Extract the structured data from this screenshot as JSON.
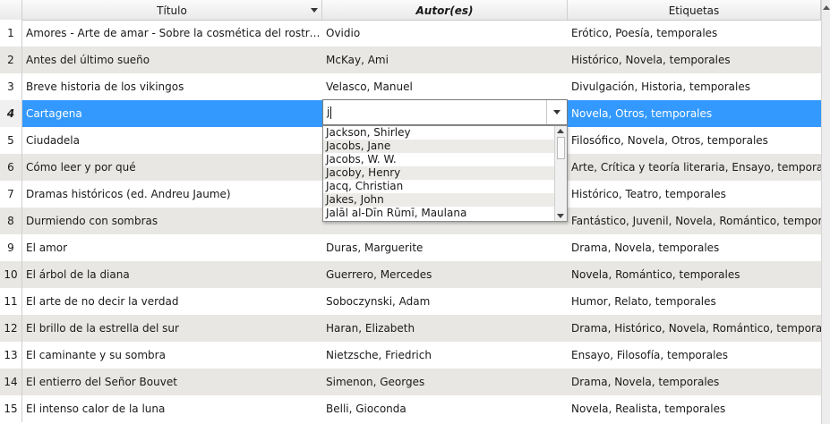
{
  "columns": {
    "title": "Título",
    "authors": "Autor(es)",
    "tags": "Etiquetas"
  },
  "rows": [
    {
      "num": "1",
      "title": "Amores - Arte de amar - Sobre la cosmética del rostro femenino",
      "author": "Ovidio",
      "tags": "Erótico, Poesía, temporales"
    },
    {
      "num": "2",
      "title": "Antes del último sueño",
      "author": "McKay, Ami",
      "tags": "Histórico, Novela, temporales"
    },
    {
      "num": "3",
      "title": "Breve historia de los vikingos",
      "author": "Velasco, Manuel",
      "tags": "Divulgación, Historia, temporales"
    },
    {
      "num": "4",
      "title": "Cartagena",
      "author": "",
      "tags": "Novela, Otros, temporales"
    },
    {
      "num": "5",
      "title": "Ciudadela",
      "author": "",
      "tags": "Filosófico, Novela, Otros, temporales"
    },
    {
      "num": "6",
      "title": "Cómo leer y por qué",
      "author": "",
      "tags": "Arte, Crítica y teoría literaria, Ensayo, temporales"
    },
    {
      "num": "7",
      "title": "Dramas históricos (ed. Andreu Jaume)",
      "author": "",
      "tags": "Histórico, Teatro, temporales"
    },
    {
      "num": "8",
      "title": "Durmiendo con sombras",
      "author": "",
      "tags": "Fantástico, Juvenil, Novela, Romántico, temporales"
    },
    {
      "num": "9",
      "title": "El amor",
      "author": "Duras, Marguerite",
      "tags": "Drama, Novela, temporales"
    },
    {
      "num": "10",
      "title": "El árbol de la diana",
      "author": "Guerrero, Mercedes",
      "tags": "Novela, Romántico, temporales"
    },
    {
      "num": "11",
      "title": "El arte de no decir la verdad",
      "author": "Soboczynski, Adam",
      "tags": "Humor, Relato, temporales"
    },
    {
      "num": "12",
      "title": "El brillo de la estrella del sur",
      "author": "Haran, Elizabeth",
      "tags": "Drama, Histórico, Novela, Romántico, temporales"
    },
    {
      "num": "13",
      "title": "El caminante y su sombra",
      "author": "Nietzsche, Friedrich",
      "tags": "Ensayo, Filosofía, temporales"
    },
    {
      "num": "14",
      "title": "El entierro del Señor Bouvet",
      "author": "Simenon, Georges",
      "tags": "Drama, Novela, temporales"
    },
    {
      "num": "15",
      "title": "El intenso calor de la luna",
      "author": "Belli, Gioconda",
      "tags": "Novela, Realista, temporales"
    }
  ],
  "editor": {
    "value": "j"
  },
  "suggestions": [
    "Jackson, Shirley",
    "Jacobs, Jane",
    "Jacobs, W. W.",
    "Jacoby, Henry",
    "Jacq, Christian",
    "Jakes, John",
    "Jalāl al-Dīn Rūmī, Maulana"
  ],
  "colors": {
    "selection": "#3399ff",
    "alt_row": "#e9e7e3"
  }
}
